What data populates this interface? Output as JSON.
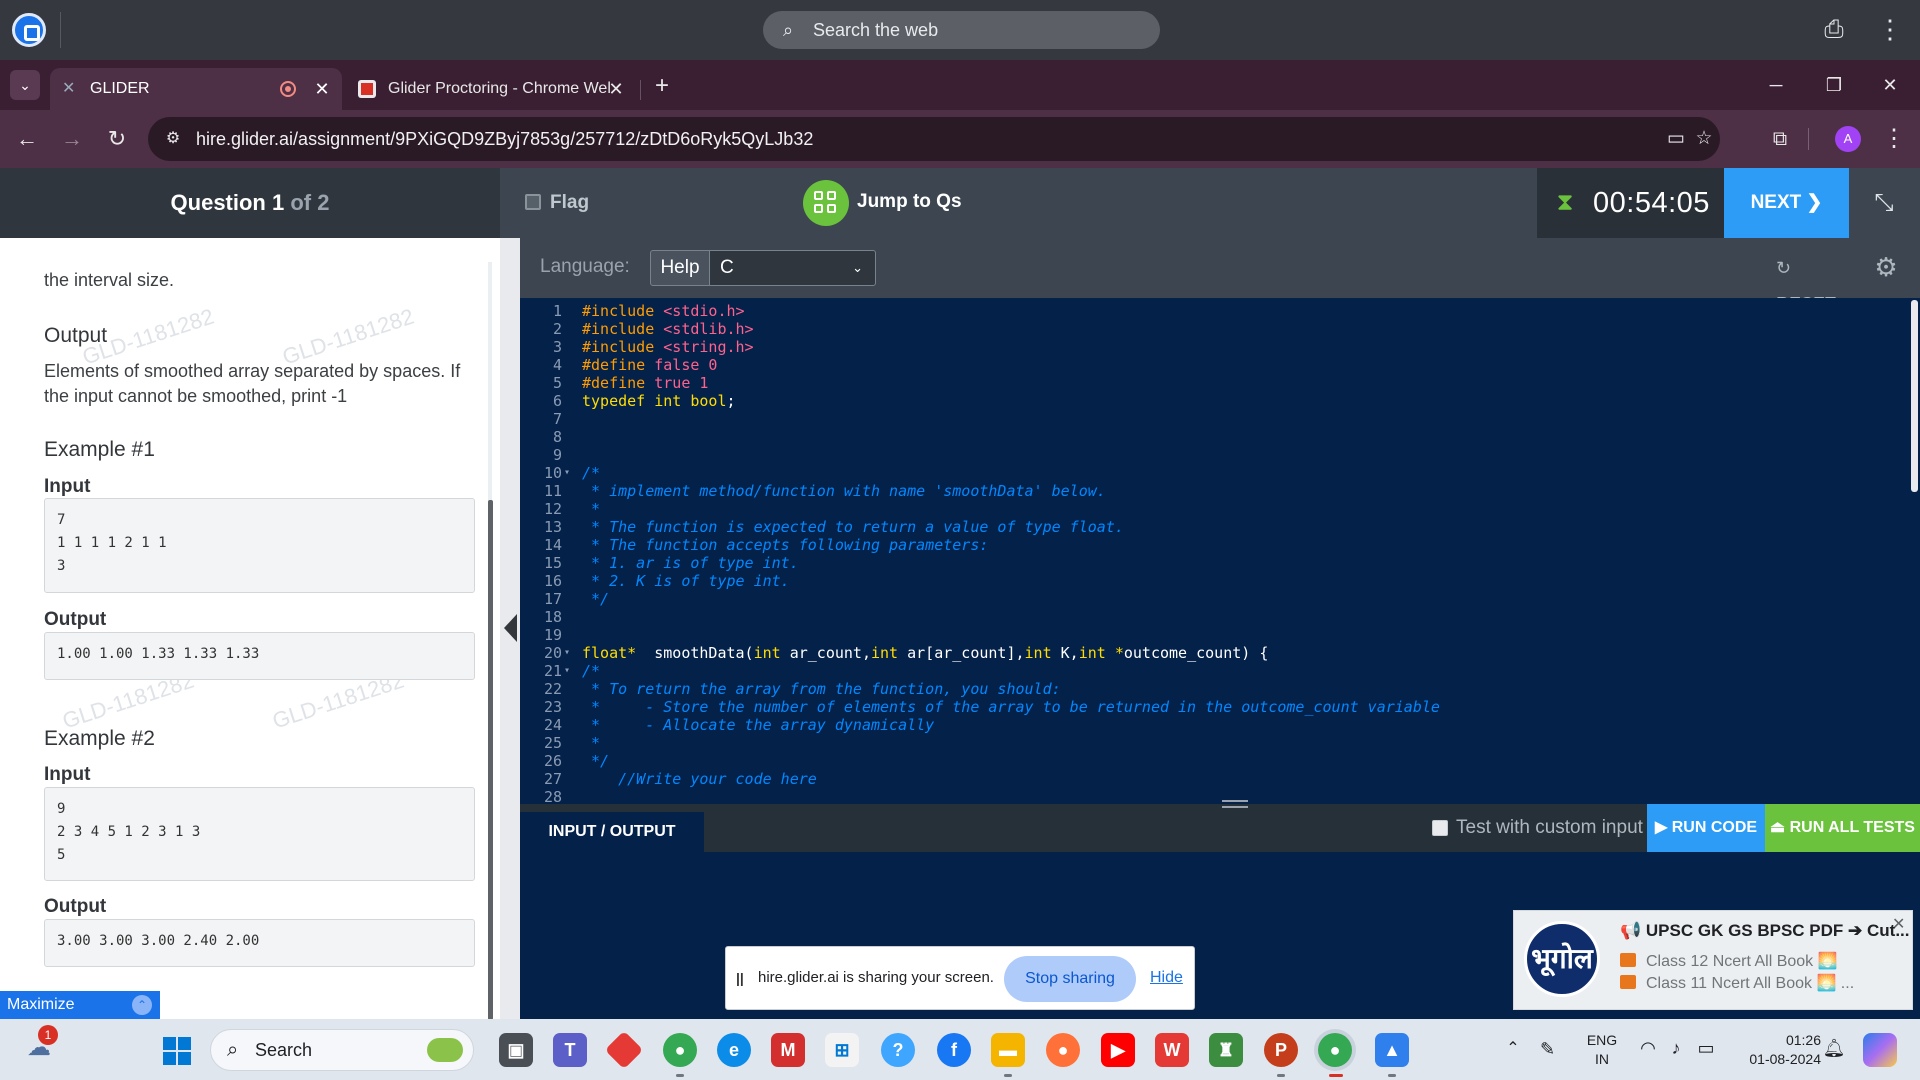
{
  "browser": {
    "search_placeholder": "Search the web",
    "tabs": [
      {
        "label": "GLIDER"
      },
      {
        "label": "Glider Proctoring - Chrome Wel"
      }
    ],
    "url": "hire.glider.ai/assignment/9PXiGQD9ZByj7853g/257712/zDtD6oRyk5QyLJb32",
    "profile_initial": "A"
  },
  "header": {
    "question_prefix": "Question 1",
    "question_of": "of 2",
    "flag_label": "Flag",
    "jump_label": "Jump to Qs",
    "timer": "00:54:05",
    "next_label": "NEXT ❯"
  },
  "problem": {
    "watermark": "GLD-1181282",
    "interval_text": "the interval size.",
    "output_heading": "Output",
    "output_desc": "Elements of smoothed array separated by spaces. If the input cannot be smoothed, print -1",
    "examples": [
      {
        "title": "Example #1",
        "input_label": "Input",
        "input": "7\n1 1 1 1 2 1 1\n3",
        "output_label": "Output",
        "output": "1.00 1.00 1.33 1.33 1.33"
      },
      {
        "title": "Example #2",
        "input_label": "Input",
        "input": "9\n2 3 4 5 1 2 3 1 3\n5",
        "output_label": "Output",
        "output": "3.00 3.00 3.00 2.40 2.00"
      }
    ],
    "maximize_label": "Maximize"
  },
  "editor_toolbar": {
    "language_label": "Language:",
    "help_label": "Help",
    "language_value": "C",
    "reset_label": "RESET"
  },
  "code_lines": [
    {
      "n": "1",
      "t": "#include <stdio.h>"
    },
    {
      "n": "2",
      "t": "#include <stdlib.h>"
    },
    {
      "n": "3",
      "t": "#include <string.h>"
    },
    {
      "n": "4",
      "t": "#define false 0"
    },
    {
      "n": "5",
      "t": "#define true 1"
    },
    {
      "n": "6",
      "t": "typedef int bool;"
    },
    {
      "n": "7",
      "t": ""
    },
    {
      "n": "8",
      "t": ""
    },
    {
      "n": "9",
      "t": ""
    },
    {
      "n": "10",
      "t": "/*"
    },
    {
      "n": "11",
      "t": " * implement method/function with name 'smoothData' below."
    },
    {
      "n": "12",
      "t": " *"
    },
    {
      "n": "13",
      "t": " * The function is expected to return a value of type float."
    },
    {
      "n": "14",
      "t": " * The function accepts following parameters:"
    },
    {
      "n": "15",
      "t": " * 1. ar is of type int."
    },
    {
      "n": "16",
      "t": " * 2. K is of type int."
    },
    {
      "n": "17",
      "t": " */"
    },
    {
      "n": "18",
      "t": ""
    },
    {
      "n": "19",
      "t": ""
    },
    {
      "n": "20",
      "t": "float*  smoothData(int ar_count,int ar[ar_count],int K,int *outcome_count) {"
    },
    {
      "n": "21",
      "t": "/*"
    },
    {
      "n": "22",
      "t": " * To return the array from the function, you should:"
    },
    {
      "n": "23",
      "t": " *     - Store the number of elements of the array to be returned in the outcome_count variable"
    },
    {
      "n": "24",
      "t": " *     - Allocate the array dynamically"
    },
    {
      "n": "25",
      "t": " *"
    },
    {
      "n": "26",
      "t": " */"
    },
    {
      "n": "27",
      "t": "    //Write your code here"
    },
    {
      "n": "28",
      "t": ""
    }
  ],
  "io": {
    "tab_label": "INPUT / OUTPUT",
    "custom_input_label": "Test with custom input",
    "run_code_label": "▶ RUN CODE",
    "run_all_label": "⏏ RUN ALL TESTS"
  },
  "share": {
    "pause_glyph": "||",
    "message": "hire.glider.ai is sharing your screen.",
    "stop_label": "Stop sharing",
    "hide_label": "Hide"
  },
  "notification": {
    "avatar_text": "भूगोल",
    "title": "📢 UPSC GK GS BPSC PDF ➔ Cut...",
    "line1": "Class 12 Ncert All Book 🌅",
    "line2": "Class 11 Ncert All Book 🌅 ..."
  },
  "taskbar": {
    "weather_badge": "1",
    "search_label": "Search",
    "lang_line1": "ENG",
    "lang_line2": "IN",
    "time": "01:26",
    "date": "01-08-2024"
  },
  "colors": {
    "accent_blue": "#2d9cf6",
    "accent_green": "#6ac23d",
    "editor_bg": "#04214a"
  }
}
